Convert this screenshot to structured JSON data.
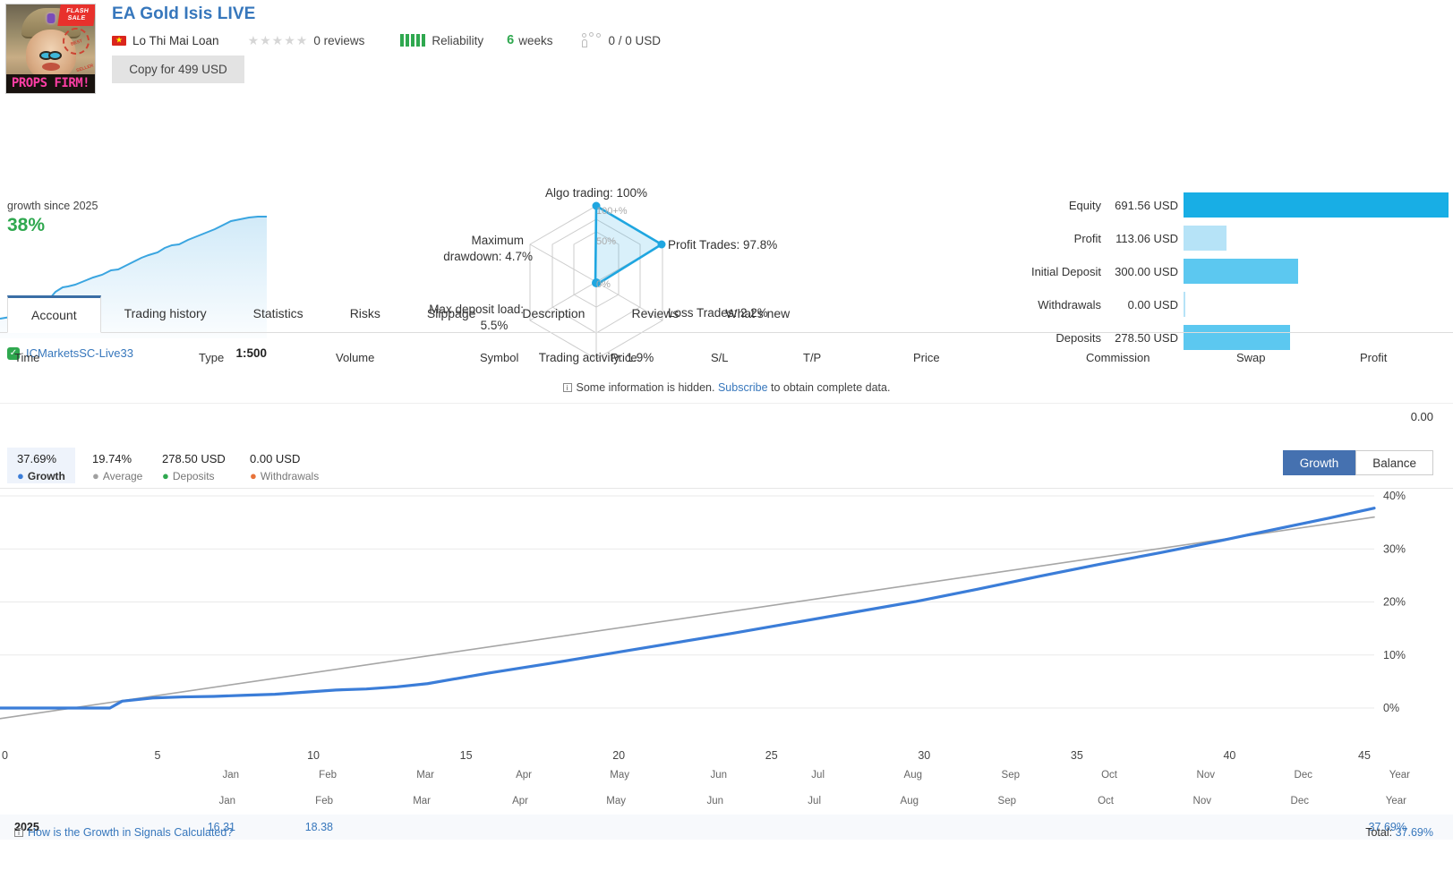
{
  "header": {
    "title": "EA Gold Isis LIVE",
    "author": "Lo Thi Mai Loan",
    "reviews": "0 reviews",
    "reliability": "Reliability",
    "weeks_value": "6",
    "weeks_label": "weeks",
    "subscribers": "0 / 0 USD",
    "copy_button": "Copy for 499 USD",
    "avatar_flash": "FLASH SALE",
    "avatar_seal": "BEST SELLER",
    "avatar_brand": "PROPS FIRM!"
  },
  "growth_panel": {
    "caption": "growth since 2025",
    "value": "38%",
    "account": "ICMarketsSC-Live33",
    "leverage": "1:500"
  },
  "radar": {
    "axes": [
      {
        "label": "Algo trading: 100%",
        "value": 100
      },
      {
        "label": "Profit Trades: 97.8%",
        "value": 97.8
      },
      {
        "label": "Loss Trades: 2.2%",
        "value": 2.2
      },
      {
        "label": "Trading activity: 1.9%",
        "value": 1.9
      },
      {
        "label": "Max deposit load: 5.5%",
        "value": 5.5
      },
      {
        "label": "Maximum drawdown: 4.7%",
        "value": 4.7
      }
    ],
    "ring_labels": [
      "100+%",
      "50%",
      "0%"
    ],
    "accent": "#1fa6e0"
  },
  "stat_bars": {
    "rows": [
      {
        "label": "Equity",
        "value": "691.56 USD",
        "num": 691.56,
        "color": "#18aee5"
      },
      {
        "label": "Profit",
        "value": "113.06 USD",
        "num": 113.06,
        "color": "#b6e3f7"
      },
      {
        "label": "Initial Deposit",
        "value": "300.00 USD",
        "num": 300.0,
        "color": "#5cc8f0"
      },
      {
        "label": "Withdrawals",
        "value": "0.00 USD",
        "num": 0.0,
        "color": "#b6e3f7"
      },
      {
        "label": "Deposits",
        "value": "278.50 USD",
        "num": 278.5,
        "color": "#5cc8f0"
      }
    ],
    "max": 691.56
  },
  "tabs": [
    {
      "label": "Account",
      "active": true
    },
    {
      "label": "Trading history",
      "active": false
    },
    {
      "label": "Statistics",
      "active": false
    },
    {
      "label": "Risks",
      "active": false
    },
    {
      "label": "Slippage",
      "active": false
    },
    {
      "label": "Description",
      "active": false
    },
    {
      "label": "Reviews",
      "active": false
    },
    {
      "label": "What's new",
      "active": false
    }
  ],
  "table": {
    "columns": [
      "Time",
      "Type",
      "Volume",
      "Symbol",
      "Price",
      "S/L",
      "T/P",
      "Price",
      "Commission",
      "Swap",
      "Profit"
    ],
    "hidden_note_pre": "Some information is hidden.",
    "hidden_note_link": "Subscribe",
    "hidden_note_post": "to obtain complete data.",
    "total_value": "0.00"
  },
  "chart_legend": {
    "items": [
      {
        "value": "37.69%",
        "name": "Growth",
        "color": "#3b7dd8",
        "selected": true
      },
      {
        "value": "19.74%",
        "name": "Average",
        "color": "#a0a0a0",
        "selected": false
      },
      {
        "value": "278.50 USD",
        "name": "Deposits",
        "color": "#2fa84f",
        "selected": false
      },
      {
        "value": "0.00 USD",
        "name": "Withdrawals",
        "color": "#e8733a",
        "selected": false
      }
    ],
    "toggle": [
      {
        "label": "Growth",
        "on": true
      },
      {
        "label": "Balance",
        "on": false
      }
    ]
  },
  "chart_data": {
    "type": "line",
    "title": "",
    "xlabel": "",
    "ylabel": "",
    "xlim": [
      0,
      45
    ],
    "ylim": [
      0,
      40
    ],
    "xticks": [
      0,
      5,
      10,
      15,
      20,
      25,
      30,
      35,
      40,
      45
    ],
    "xtick_labels": [
      "0",
      "5",
      "10",
      "15",
      "20",
      "25",
      "30",
      "35",
      "40",
      "45"
    ],
    "yticks": [
      0,
      10,
      20,
      30,
      40
    ],
    "ytick_labels": [
      "0%",
      "10%",
      "20%",
      "30%",
      "40%"
    ],
    "grid": true,
    "month_labels": [
      "Jan",
      "Feb",
      "Mar",
      "Apr",
      "May",
      "Jun",
      "Jul",
      "Aug",
      "Sep",
      "Oct",
      "Nov",
      "Dec",
      "Year"
    ],
    "series": [
      {
        "name": "Growth",
        "color": "#3b7dd8",
        "x": [
          0,
          3.6,
          4.0,
          5.0,
          6.0,
          7.0,
          8.0,
          9.0,
          10.0,
          11.0,
          12.0,
          13.0,
          14.0,
          16.0,
          18.0,
          20.0,
          22.0,
          24.0,
          26.0,
          28.0,
          30.0,
          32.0,
          34.0,
          36.0,
          38.0,
          40.0,
          42.0,
          43.5,
          45.0
        ],
        "y": [
          0.0,
          0.0,
          1.3,
          1.9,
          2.1,
          2.2,
          2.4,
          2.6,
          3.0,
          3.4,
          3.6,
          4.0,
          4.6,
          6.6,
          8.4,
          10.3,
          12.2,
          14.1,
          16.1,
          18.1,
          20.1,
          22.4,
          24.8,
          27.1,
          29.3,
          31.6,
          34.0,
          35.8,
          37.69
        ]
      },
      {
        "name": "Average",
        "color": "#a6a6a6",
        "x": [
          0,
          45
        ],
        "y": [
          -2.0,
          36.0
        ]
      }
    ],
    "pre_segment": {
      "name": "Growth (pre-start)",
      "color": "#dbe6f8",
      "x": [
        0,
        3.6
      ],
      "y": [
        0.0,
        0.0
      ]
    }
  },
  "monthly_table": {
    "header_months": [
      "Jan",
      "Feb",
      "Mar",
      "Apr",
      "May",
      "Jun",
      "Jul",
      "Aug",
      "Sep",
      "Oct",
      "Nov",
      "Dec",
      "Year"
    ],
    "rows": [
      {
        "year": "2025",
        "values": [
          "16.31",
          "18.38",
          "",
          "",
          "",
          "",
          "",
          "",
          "",
          "",
          "",
          "",
          "37.69%"
        ]
      }
    ]
  },
  "footer": {
    "link": "How is the Growth in Signals Calculated?",
    "total_label": "Total:",
    "total_value": "37.69%"
  }
}
